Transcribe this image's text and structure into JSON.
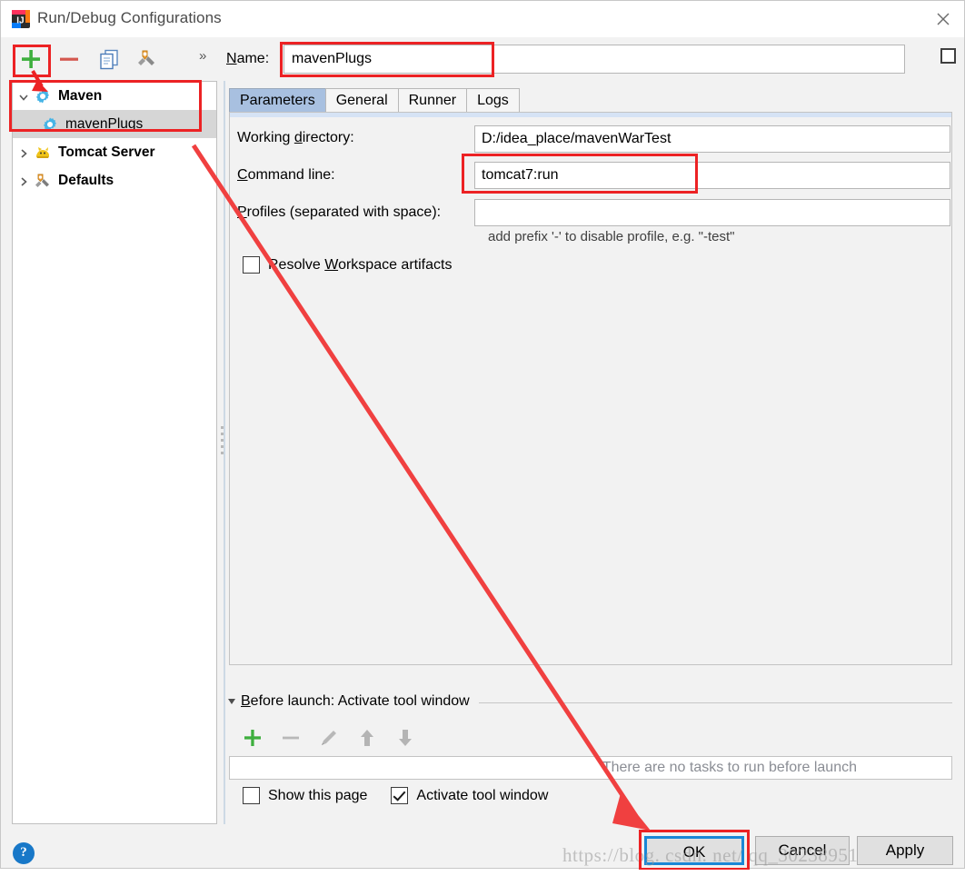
{
  "window": {
    "title": "Run/Debug Configurations",
    "app_icon": "intellij-idea-icon",
    "close_icon": "close-icon"
  },
  "toolbar": {
    "add_label": "+",
    "remove_label": "–",
    "copy_label": "copy-configuration-icon",
    "settings_label": "edit-templates-icon",
    "more_label": "»"
  },
  "tree": {
    "items": [
      {
        "label": "Maven",
        "icon": "maven-gear-icon",
        "twisty": "expanded",
        "level": 0,
        "selected": false
      },
      {
        "label": "mavenPlugs",
        "icon": "maven-gear-icon",
        "twisty": "",
        "level": 1,
        "selected": true
      },
      {
        "label": "Tomcat Server",
        "icon": "tomcat-cat-icon",
        "twisty": "collapsed",
        "level": 0,
        "selected": false
      },
      {
        "label": "Defaults",
        "icon": "wrench-icon",
        "twisty": "collapsed",
        "level": 0,
        "selected": false
      }
    ]
  },
  "name_row": {
    "label_prefix": "N",
    "label_rest": "ame:",
    "value": "mavenPlugs",
    "placeholder": ""
  },
  "tabs": [
    {
      "label": "Parameters",
      "active": true
    },
    {
      "label": "General",
      "active": false
    },
    {
      "label": "Runner",
      "active": false
    },
    {
      "label": "Logs",
      "active": false
    }
  ],
  "parameters": {
    "working_directory": {
      "label_a": "Working ",
      "label_u": "d",
      "label_b": "irectory:",
      "value": "D:/idea_place/mavenWarTest"
    },
    "command_line": {
      "label_u": "C",
      "label_b": "ommand line:",
      "value": "tomcat7:run"
    },
    "profiles": {
      "label_u": "P",
      "label_b": "rofiles (separated with space):",
      "value": ""
    },
    "hint": "add prefix '-' to disable profile, e.g. \"-test\"",
    "resolve_workspace": {
      "checked": false,
      "label_a": "Resolve ",
      "label_u": "W",
      "label_b": "orkspace artifacts"
    }
  },
  "before_launch": {
    "title_u": "B",
    "title_b": "efore launch: Activate tool window",
    "toolbar": {
      "add": "add-task-icon",
      "remove": "remove-task-icon",
      "edit": "edit-task-icon",
      "up": "move-up-icon",
      "down": "move-down-icon"
    },
    "empty_text": "There are no tasks to run before launch",
    "show_page": {
      "checked": false,
      "label": "Show this page"
    },
    "activate_tool_window": {
      "checked": true,
      "label": "Activate tool window"
    }
  },
  "help": {
    "label": "?"
  },
  "buttons": {
    "ok": "OK",
    "cancel": "Cancel",
    "apply": "Apply"
  },
  "watermark": "https://blog. csdn. net/ qq_30238951",
  "colors": {
    "annotation_red": "#ec2224",
    "focus_blue": "#1a87d6",
    "active_tab": "#a8c0e0",
    "selection_gray": "#d6d6d6",
    "help_blue": "#1878c8"
  }
}
